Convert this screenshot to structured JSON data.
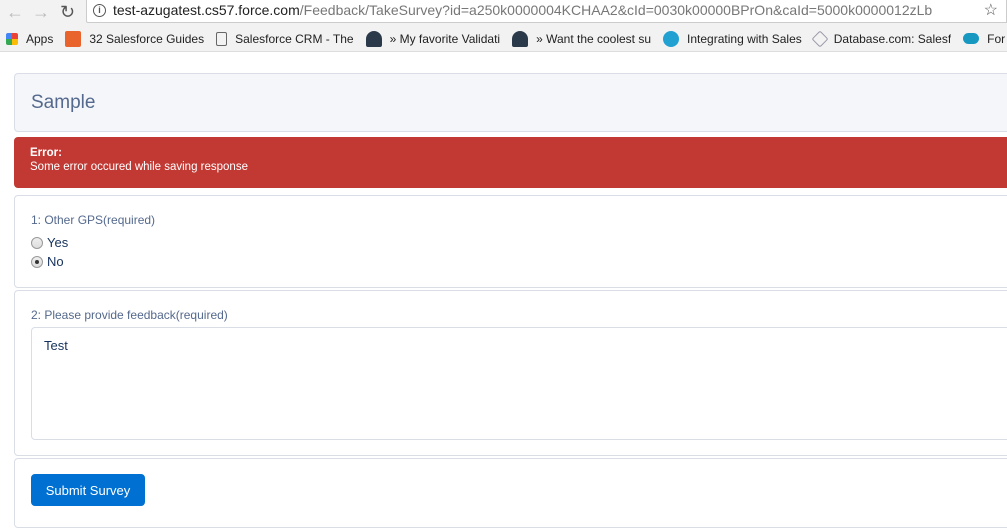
{
  "browser": {
    "url_host": "test-azugatest.cs57.force.com",
    "url_path": "/Feedback/TakeSurvey?id=a250k0000004KCHAA2&cId=0030k00000BPrOn&caId=5000k0000012zLb",
    "bookmarks": [
      {
        "label": "Apps"
      },
      {
        "label": "32 Salesforce Guides"
      },
      {
        "label": "Salesforce CRM - The"
      },
      {
        "label": "» My favorite Validati"
      },
      {
        "label": "» Want the coolest su"
      },
      {
        "label": "Integrating with Sales"
      },
      {
        "label": "Database.com: Salesf"
      },
      {
        "label": "For"
      }
    ]
  },
  "survey": {
    "title": "Sample",
    "error": {
      "heading": "Error:",
      "message": "Some error occured while saving response"
    },
    "q1": {
      "label": "1: Other GPS(required)",
      "options": [
        "Yes",
        "No"
      ],
      "selected": "No"
    },
    "q2": {
      "label": "2: Please provide feedback(required)",
      "value": "Test"
    },
    "submit_label": "Submit Survey"
  },
  "colors": {
    "error": "#c23934",
    "primary": "#0070d2"
  }
}
